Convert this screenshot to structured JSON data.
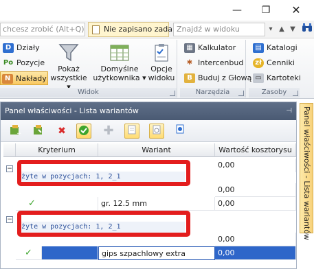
{
  "window": {
    "minimize_glyph": "—",
    "restore_glyph": "❐",
    "close_glyph": "✕"
  },
  "search_strip": {
    "tell_me_placeholder": "chcesz zrobić (Alt+Q)",
    "document_tab": "Nie zapisano zadań",
    "find_placeholder": "Znajdź w widoku",
    "find_up_glyph": "▲",
    "find_down_glyph": "▼",
    "find_options_glyph": "▾"
  },
  "ribbon": {
    "groups": {
      "widok": {
        "label": "Widok"
      },
      "narzedzia": {
        "label": "Narzędzia"
      },
      "zasoby": {
        "label": "Zasoby"
      }
    },
    "views": [
      {
        "label": "Działy",
        "icon": "D"
      },
      {
        "label": "Pozycje",
        "icon": "Po"
      },
      {
        "label": "Nakłady",
        "icon": "N"
      }
    ],
    "pokaz_wszystkie": {
      "line1": "Pokaż",
      "line2": "wszystkie ▾"
    },
    "domyslne": {
      "line1": "Domyślne",
      "line2": "użytkownika ▾"
    },
    "opcje": {
      "line1": "Opcje",
      "line2": "widoku"
    },
    "tools": [
      {
        "label": "Kalkulator"
      },
      {
        "label": "Intercenbud"
      },
      {
        "label": "Buduj z Głową"
      }
    ],
    "resources": [
      {
        "label": "Katalogi"
      },
      {
        "label": "Cenniki"
      },
      {
        "label": "Kartoteki"
      }
    ]
  },
  "panel": {
    "title": "Panel właściwości - Lista wariantów",
    "pin_glyph": "⊣",
    "side_tab": "Panel właściwości - Lista wariantów",
    "columns": [
      "Kryterium",
      "Wariant",
      "Wartość kosztorysu"
    ],
    "groups": [
      {
        "header": "użyte w pozycjach: 1, 2_1",
        "rows": [
          {
            "check": "✓",
            "wariant": "gr. 12.5 mm",
            "wartosc": "0,00"
          }
        ]
      },
      {
        "header": "użyte w pozycjach: 1, 2_1",
        "rows": [
          {
            "check": "✓",
            "wariant": "gips szpachlowy extra",
            "wartosc": "0,00"
          }
        ]
      }
    ],
    "hidden_value_1": "0,00",
    "hidden_value_2": "0,00",
    "collapse_glyph": "−"
  },
  "colors": {
    "accent_red": "#e31d1d",
    "selection_blue": "#2e66c9",
    "panel_title": "#4a5a73",
    "highlight_yellow": "#ffdc73"
  }
}
